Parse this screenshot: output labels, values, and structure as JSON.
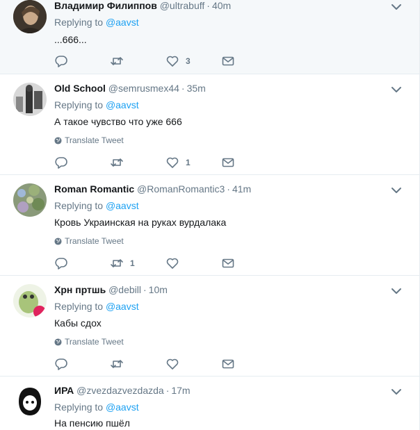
{
  "tweets": [
    {
      "name": "Владимир Филиппов",
      "handle": "@ultrabuff",
      "time": "40m",
      "replying_prefix": "Replying to",
      "replying_to": "@aavst",
      "text": "...666...",
      "translate": "",
      "replies": "",
      "retweets": "",
      "likes": "3"
    },
    {
      "name": "Old School",
      "handle": "@semrusmex44",
      "time": "35m",
      "replying_prefix": "Replying to",
      "replying_to": "@aavst",
      "text": "А такое чувство что уже 666",
      "translate": "Translate Tweet",
      "replies": "",
      "retweets": "",
      "likes": "1"
    },
    {
      "name": "Roman Romantic",
      "handle": "@RomanRomantic3",
      "time": "41m",
      "replying_prefix": "Replying to",
      "replying_to": "@aavst",
      "text": "Кровь Украинская на руках вурдалака",
      "translate": "Translate Tweet",
      "replies": "",
      "retweets": "1",
      "likes": ""
    },
    {
      "name": "Хрн пртшь",
      "handle": "@debill",
      "time": "10m",
      "replying_prefix": "Replying to",
      "replying_to": "@aavst",
      "text": "Кабы сдох",
      "translate": "Translate Tweet",
      "replies": "",
      "retweets": "",
      "likes": ""
    },
    {
      "name": "ИРА",
      "handle": "@zvezdazvezdazda",
      "time": "17m",
      "replying_prefix": "Replying to",
      "replying_to": "@aavst",
      "text": "На пенсию пшёл",
      "translate": "",
      "replies": "",
      "retweets": "",
      "likes": ""
    }
  ],
  "time_separator": "·",
  "colors": {
    "link": "#1da1f2",
    "muted": "#657786",
    "text": "#14171a",
    "border": "#e6ecf0"
  },
  "icons": [
    "reply-icon",
    "retweet-icon",
    "like-icon",
    "message-icon",
    "chevron-down-icon",
    "globe-icon"
  ]
}
